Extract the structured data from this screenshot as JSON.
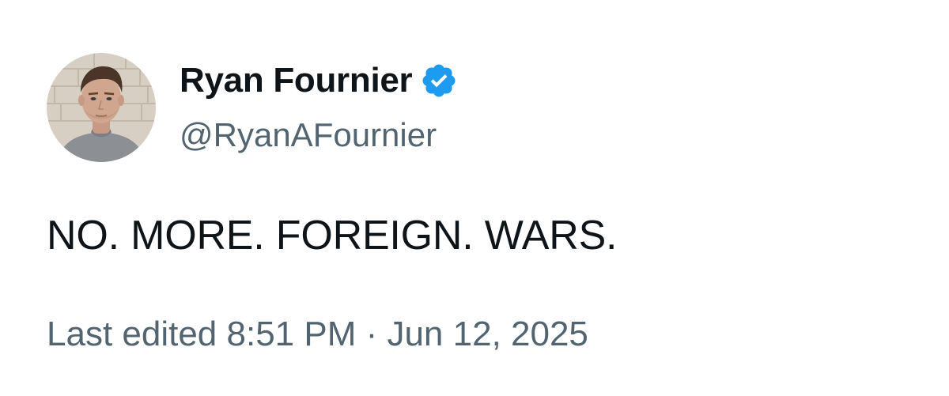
{
  "author": {
    "display_name": "Ryan Fournier",
    "handle": "@RyanAFournier",
    "verified": true,
    "verified_color": "#1d9bf0"
  },
  "tweet": {
    "text": "NO. MORE. FOREIGN. WARS."
  },
  "meta": {
    "edited_timestamp": "Last edited 8:51 PM · Jun 12, 2025"
  },
  "colors": {
    "primary_text": "#0f1419",
    "secondary_text": "#536471"
  },
  "icons": {
    "avatar": "profile-photo",
    "badge": "verified-badge-icon"
  }
}
